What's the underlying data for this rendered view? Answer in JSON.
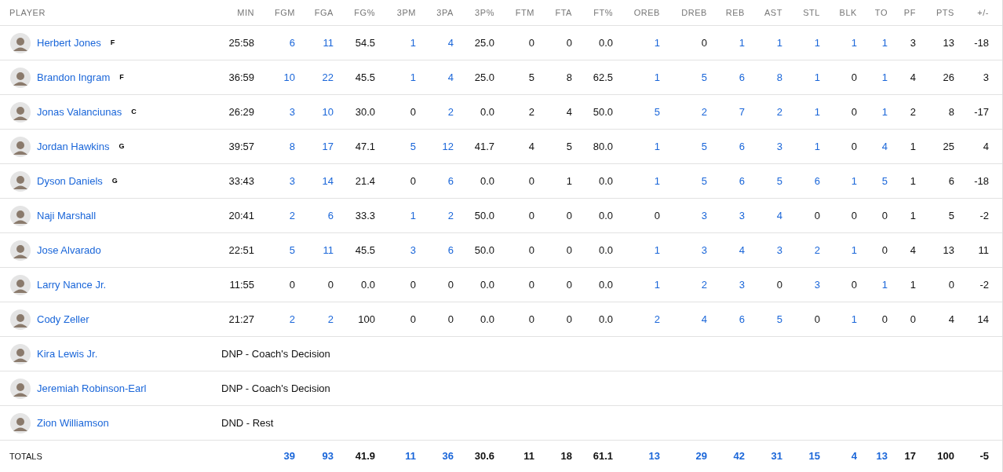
{
  "columns": [
    "PLAYER",
    "MIN",
    "FGM",
    "FGA",
    "FG%",
    "3PM",
    "3PA",
    "3P%",
    "FTM",
    "FTA",
    "FT%",
    "OREB",
    "DREB",
    "REB",
    "AST",
    "STL",
    "BLK",
    "TO",
    "PF",
    "PTS",
    "+/-"
  ],
  "players": [
    {
      "name": "Herbert Jones",
      "position": "F",
      "min": "25:58",
      "stats": [
        {
          "v": "6",
          "link": true
        },
        {
          "v": "11",
          "link": true
        },
        {
          "v": "54.5",
          "link": false
        },
        {
          "v": "1",
          "link": true
        },
        {
          "v": "4",
          "link": true
        },
        {
          "v": "25.0",
          "link": false
        },
        {
          "v": "0",
          "link": false
        },
        {
          "v": "0",
          "link": false
        },
        {
          "v": "0.0",
          "link": false
        },
        {
          "v": "1",
          "link": true
        },
        {
          "v": "0",
          "link": false
        },
        {
          "v": "1",
          "link": true
        },
        {
          "v": "1",
          "link": true
        },
        {
          "v": "1",
          "link": true
        },
        {
          "v": "1",
          "link": true
        },
        {
          "v": "1",
          "link": true
        },
        {
          "v": "3",
          "link": false
        },
        {
          "v": "13",
          "link": false
        },
        {
          "v": "-18",
          "link": false
        }
      ]
    },
    {
      "name": "Brandon Ingram",
      "position": "F",
      "min": "36:59",
      "stats": [
        {
          "v": "10",
          "link": true
        },
        {
          "v": "22",
          "link": true
        },
        {
          "v": "45.5",
          "link": false
        },
        {
          "v": "1",
          "link": true
        },
        {
          "v": "4",
          "link": true
        },
        {
          "v": "25.0",
          "link": false
        },
        {
          "v": "5",
          "link": false
        },
        {
          "v": "8",
          "link": false
        },
        {
          "v": "62.5",
          "link": false
        },
        {
          "v": "1",
          "link": true
        },
        {
          "v": "5",
          "link": true
        },
        {
          "v": "6",
          "link": true
        },
        {
          "v": "8",
          "link": true
        },
        {
          "v": "1",
          "link": true
        },
        {
          "v": "0",
          "link": false
        },
        {
          "v": "1",
          "link": true
        },
        {
          "v": "4",
          "link": false
        },
        {
          "v": "26",
          "link": false
        },
        {
          "v": "3",
          "link": false
        }
      ]
    },
    {
      "name": "Jonas Valanciunas",
      "position": "C",
      "min": "26:29",
      "stats": [
        {
          "v": "3",
          "link": true
        },
        {
          "v": "10",
          "link": true
        },
        {
          "v": "30.0",
          "link": false
        },
        {
          "v": "0",
          "link": false
        },
        {
          "v": "2",
          "link": true
        },
        {
          "v": "0.0",
          "link": false
        },
        {
          "v": "2",
          "link": false
        },
        {
          "v": "4",
          "link": false
        },
        {
          "v": "50.0",
          "link": false
        },
        {
          "v": "5",
          "link": true
        },
        {
          "v": "2",
          "link": true
        },
        {
          "v": "7",
          "link": true
        },
        {
          "v": "2",
          "link": true
        },
        {
          "v": "1",
          "link": true
        },
        {
          "v": "0",
          "link": false
        },
        {
          "v": "1",
          "link": true
        },
        {
          "v": "2",
          "link": false
        },
        {
          "v": "8",
          "link": false
        },
        {
          "v": "-17",
          "link": false
        }
      ]
    },
    {
      "name": "Jordan Hawkins",
      "position": "G",
      "min": "39:57",
      "stats": [
        {
          "v": "8",
          "link": true
        },
        {
          "v": "17",
          "link": true
        },
        {
          "v": "47.1",
          "link": false
        },
        {
          "v": "5",
          "link": true
        },
        {
          "v": "12",
          "link": true
        },
        {
          "v": "41.7",
          "link": false
        },
        {
          "v": "4",
          "link": false
        },
        {
          "v": "5",
          "link": false
        },
        {
          "v": "80.0",
          "link": false
        },
        {
          "v": "1",
          "link": true
        },
        {
          "v": "5",
          "link": true
        },
        {
          "v": "6",
          "link": true
        },
        {
          "v": "3",
          "link": true
        },
        {
          "v": "1",
          "link": true
        },
        {
          "v": "0",
          "link": false
        },
        {
          "v": "4",
          "link": true
        },
        {
          "v": "1",
          "link": false
        },
        {
          "v": "25",
          "link": false
        },
        {
          "v": "4",
          "link": false
        }
      ]
    },
    {
      "name": "Dyson Daniels",
      "position": "G",
      "min": "33:43",
      "stats": [
        {
          "v": "3",
          "link": true
        },
        {
          "v": "14",
          "link": true
        },
        {
          "v": "21.4",
          "link": false
        },
        {
          "v": "0",
          "link": false
        },
        {
          "v": "6",
          "link": true
        },
        {
          "v": "0.0",
          "link": false
        },
        {
          "v": "0",
          "link": false
        },
        {
          "v": "1",
          "link": false
        },
        {
          "v": "0.0",
          "link": false
        },
        {
          "v": "1",
          "link": true
        },
        {
          "v": "5",
          "link": true
        },
        {
          "v": "6",
          "link": true
        },
        {
          "v": "5",
          "link": true
        },
        {
          "v": "6",
          "link": true
        },
        {
          "v": "1",
          "link": true
        },
        {
          "v": "5",
          "link": true
        },
        {
          "v": "1",
          "link": false
        },
        {
          "v": "6",
          "link": false
        },
        {
          "v": "-18",
          "link": false
        }
      ]
    },
    {
      "name": "Naji Marshall",
      "min": "20:41",
      "stats": [
        {
          "v": "2",
          "link": true
        },
        {
          "v": "6",
          "link": true
        },
        {
          "v": "33.3",
          "link": false
        },
        {
          "v": "1",
          "link": true
        },
        {
          "v": "2",
          "link": true
        },
        {
          "v": "50.0",
          "link": false
        },
        {
          "v": "0",
          "link": false
        },
        {
          "v": "0",
          "link": false
        },
        {
          "v": "0.0",
          "link": false
        },
        {
          "v": "0",
          "link": false
        },
        {
          "v": "3",
          "link": true
        },
        {
          "v": "3",
          "link": true
        },
        {
          "v": "4",
          "link": true
        },
        {
          "v": "0",
          "link": false
        },
        {
          "v": "0",
          "link": false
        },
        {
          "v": "0",
          "link": false
        },
        {
          "v": "1",
          "link": false
        },
        {
          "v": "5",
          "link": false
        },
        {
          "v": "-2",
          "link": false
        }
      ]
    },
    {
      "name": "Jose Alvarado",
      "min": "22:51",
      "stats": [
        {
          "v": "5",
          "link": true
        },
        {
          "v": "11",
          "link": true
        },
        {
          "v": "45.5",
          "link": false
        },
        {
          "v": "3",
          "link": true
        },
        {
          "v": "6",
          "link": true
        },
        {
          "v": "50.0",
          "link": false
        },
        {
          "v": "0",
          "link": false
        },
        {
          "v": "0",
          "link": false
        },
        {
          "v": "0.0",
          "link": false
        },
        {
          "v": "1",
          "link": true
        },
        {
          "v": "3",
          "link": true
        },
        {
          "v": "4",
          "link": true
        },
        {
          "v": "3",
          "link": true
        },
        {
          "v": "2",
          "link": true
        },
        {
          "v": "1",
          "link": true
        },
        {
          "v": "0",
          "link": false
        },
        {
          "v": "4",
          "link": false
        },
        {
          "v": "13",
          "link": false
        },
        {
          "v": "11",
          "link": false
        }
      ]
    },
    {
      "name": "Larry Nance Jr.",
      "min": "11:55",
      "stats": [
        {
          "v": "0",
          "link": false
        },
        {
          "v": "0",
          "link": false
        },
        {
          "v": "0.0",
          "link": false
        },
        {
          "v": "0",
          "link": false
        },
        {
          "v": "0",
          "link": false
        },
        {
          "v": "0.0",
          "link": false
        },
        {
          "v": "0",
          "link": false
        },
        {
          "v": "0",
          "link": false
        },
        {
          "v": "0.0",
          "link": false
        },
        {
          "v": "1",
          "link": true
        },
        {
          "v": "2",
          "link": true
        },
        {
          "v": "3",
          "link": true
        },
        {
          "v": "0",
          "link": false
        },
        {
          "v": "3",
          "link": true
        },
        {
          "v": "0",
          "link": false
        },
        {
          "v": "1",
          "link": true
        },
        {
          "v": "1",
          "link": false
        },
        {
          "v": "0",
          "link": false
        },
        {
          "v": "-2",
          "link": false
        }
      ]
    },
    {
      "name": "Cody Zeller",
      "min": "21:27",
      "stats": [
        {
          "v": "2",
          "link": true
        },
        {
          "v": "2",
          "link": true
        },
        {
          "v": "100",
          "link": false
        },
        {
          "v": "0",
          "link": false
        },
        {
          "v": "0",
          "link": false
        },
        {
          "v": "0.0",
          "link": false
        },
        {
          "v": "0",
          "link": false
        },
        {
          "v": "0",
          "link": false
        },
        {
          "v": "0.0",
          "link": false
        },
        {
          "v": "2",
          "link": true
        },
        {
          "v": "4",
          "link": true
        },
        {
          "v": "6",
          "link": true
        },
        {
          "v": "5",
          "link": true
        },
        {
          "v": "0",
          "link": false
        },
        {
          "v": "1",
          "link": true
        },
        {
          "v": "0",
          "link": false
        },
        {
          "v": "0",
          "link": false
        },
        {
          "v": "4",
          "link": false
        },
        {
          "v": "14",
          "link": false
        }
      ]
    },
    {
      "name": "Kira Lewis Jr.",
      "note": "DNP - Coach's Decision"
    },
    {
      "name": "Jeremiah Robinson-Earl",
      "note": "DNP - Coach's Decision"
    },
    {
      "name": "Zion Williamson",
      "note": "DND - Rest"
    }
  ],
  "totals": {
    "label": "TOTALS",
    "stats": [
      {
        "v": "39",
        "link": true
      },
      {
        "v": "93",
        "link": true
      },
      {
        "v": "41.9",
        "link": false
      },
      {
        "v": "11",
        "link": true
      },
      {
        "v": "36",
        "link": true
      },
      {
        "v": "30.6",
        "link": false
      },
      {
        "v": "11",
        "link": false
      },
      {
        "v": "18",
        "link": false
      },
      {
        "v": "61.1",
        "link": false
      },
      {
        "v": "13",
        "link": true
      },
      {
        "v": "29",
        "link": true
      },
      {
        "v": "42",
        "link": true
      },
      {
        "v": "31",
        "link": true
      },
      {
        "v": "15",
        "link": true
      },
      {
        "v": "4",
        "link": true
      },
      {
        "v": "13",
        "link": true
      },
      {
        "v": "17",
        "link": false
      },
      {
        "v": "100",
        "link": false
      },
      {
        "v": "-5",
        "link": false
      }
    ]
  }
}
